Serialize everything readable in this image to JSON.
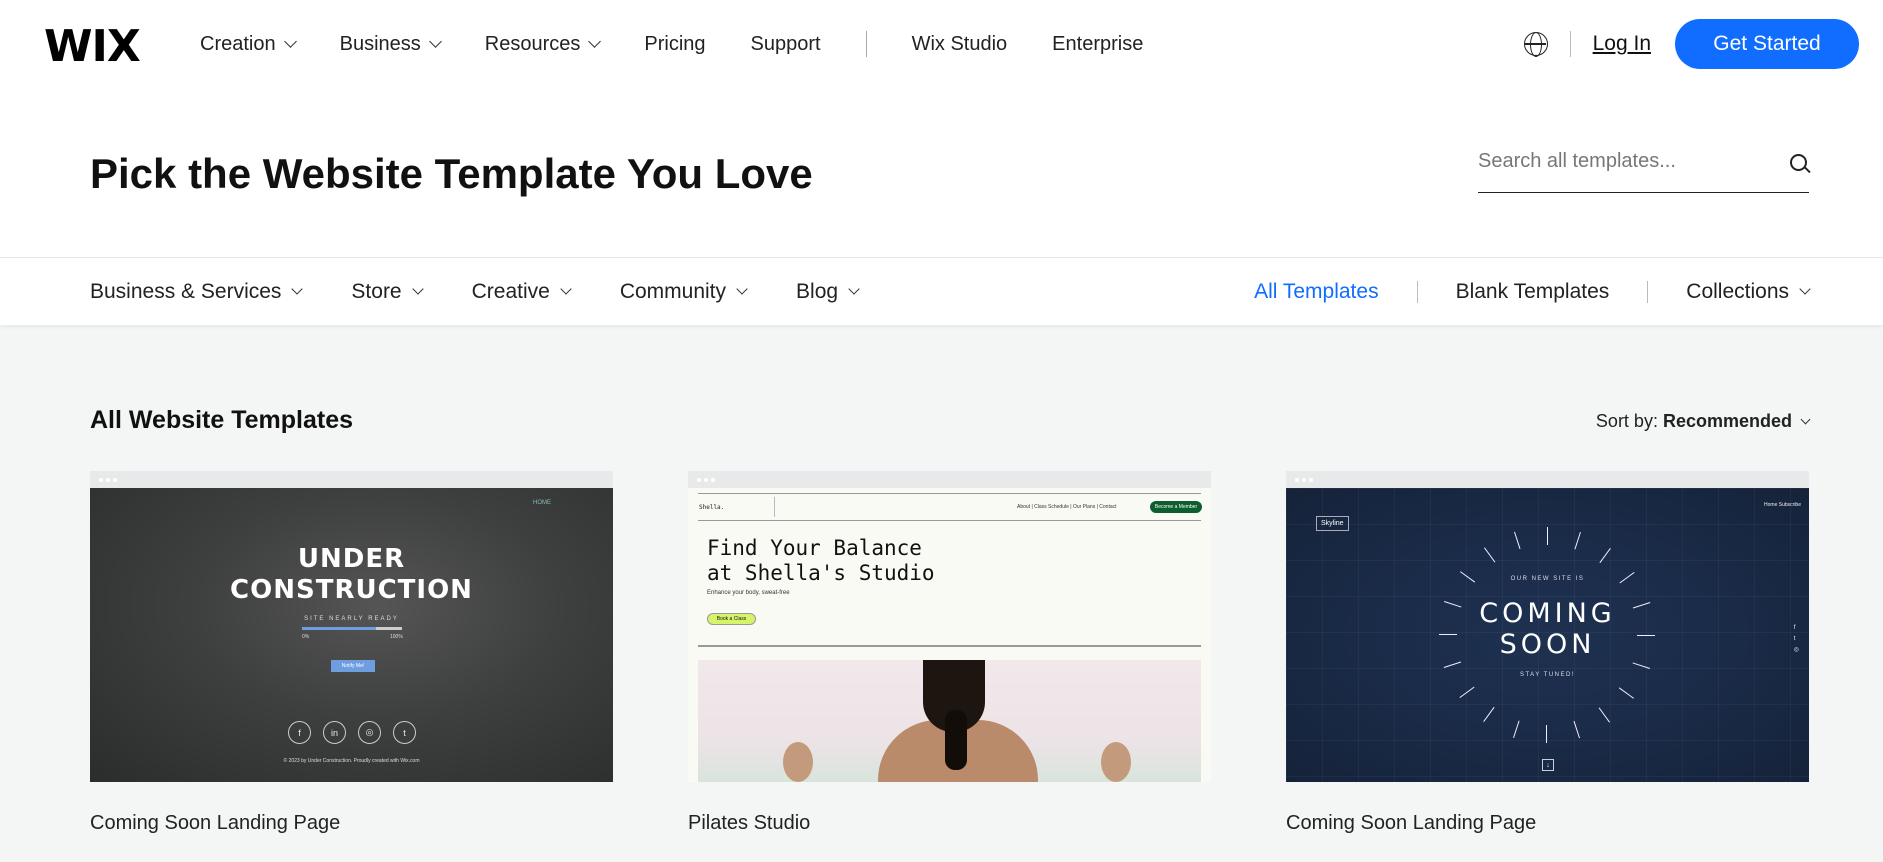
{
  "topnav": {
    "logo": "WIX",
    "items": [
      "Creation",
      "Business",
      "Resources",
      "Pricing",
      "Support"
    ],
    "items_secondary": [
      "Wix Studio",
      "Enterprise"
    ],
    "login": "Log In",
    "cta": "Get Started",
    "cta_color": "#116dff"
  },
  "hero": {
    "title": "Pick the Website Template You Love",
    "search_placeholder": "Search all templates..."
  },
  "categories": {
    "items": [
      "Business & Services",
      "Store",
      "Creative",
      "Community",
      "Blog"
    ],
    "right": [
      "All Templates",
      "Blank Templates",
      "Collections"
    ],
    "active_color": "#116dff"
  },
  "section": {
    "title": "All Website Templates",
    "sort_label": "Sort by:",
    "sort_value": "Recommended"
  },
  "cards": [
    {
      "name": "Coming Soon Landing Page",
      "thumb": {
        "nav": "HOME",
        "headline_1": "UNDER",
        "headline_2": "CONSTRUCTION",
        "sub": "SITE NEARLY READY",
        "progress": 0.74,
        "pct_start": "0%",
        "pct_end": "100%",
        "button": "Notify Me!",
        "socials": [
          "f",
          "in",
          "◎",
          "t"
        ],
        "footer": "© 2023 by Under Construction. Proudly created with Wix.com"
      }
    },
    {
      "name": "Pilates Studio",
      "thumb": {
        "brand": "Shella.",
        "menu": "About  |  Class Schedule  |  Our Plans  |  Contact",
        "cta": "Become a Member",
        "headline_1": "Find Your Balance",
        "headline_2": "at Shella's Studio",
        "sub": "Enhance your body, sweat-free",
        "button": "Book a Class"
      }
    },
    {
      "name": "Coming Soon Landing Page",
      "thumb": {
        "brand": "Skyline",
        "menu": "Home    Subscribe",
        "kicker": "OUR NEW SITE IS",
        "headline_1": "COMING",
        "headline_2": "SOON",
        "stay": "STAY TUNED!",
        "side_icons": [
          "f",
          "t",
          "◎"
        ],
        "down_icon": "↓"
      }
    }
  ]
}
